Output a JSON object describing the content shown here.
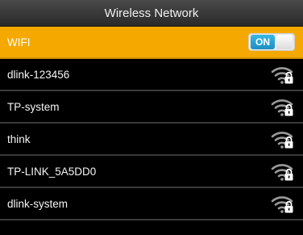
{
  "header": {
    "title": "Wireless Network"
  },
  "wifi_toggle": {
    "label": "WIFI",
    "state_label": "ON",
    "enabled": true
  },
  "networks": [
    {
      "ssid": "dlink-123456",
      "secured": true,
      "icon": "wifi-lock-icon"
    },
    {
      "ssid": "TP-system",
      "secured": true,
      "icon": "wifi-lock-icon"
    },
    {
      "ssid": "think",
      "secured": true,
      "icon": "wifi-lock-icon"
    },
    {
      "ssid": "TP-LINK_5A5DD0",
      "secured": true,
      "icon": "wifi-lock-icon"
    },
    {
      "ssid": "dlink-system",
      "secured": true,
      "icon": "wifi-lock-icon"
    }
  ],
  "colors": {
    "selected_row": "#f5a900",
    "toggle_on": "#1d8fc2",
    "background": "#000000"
  }
}
